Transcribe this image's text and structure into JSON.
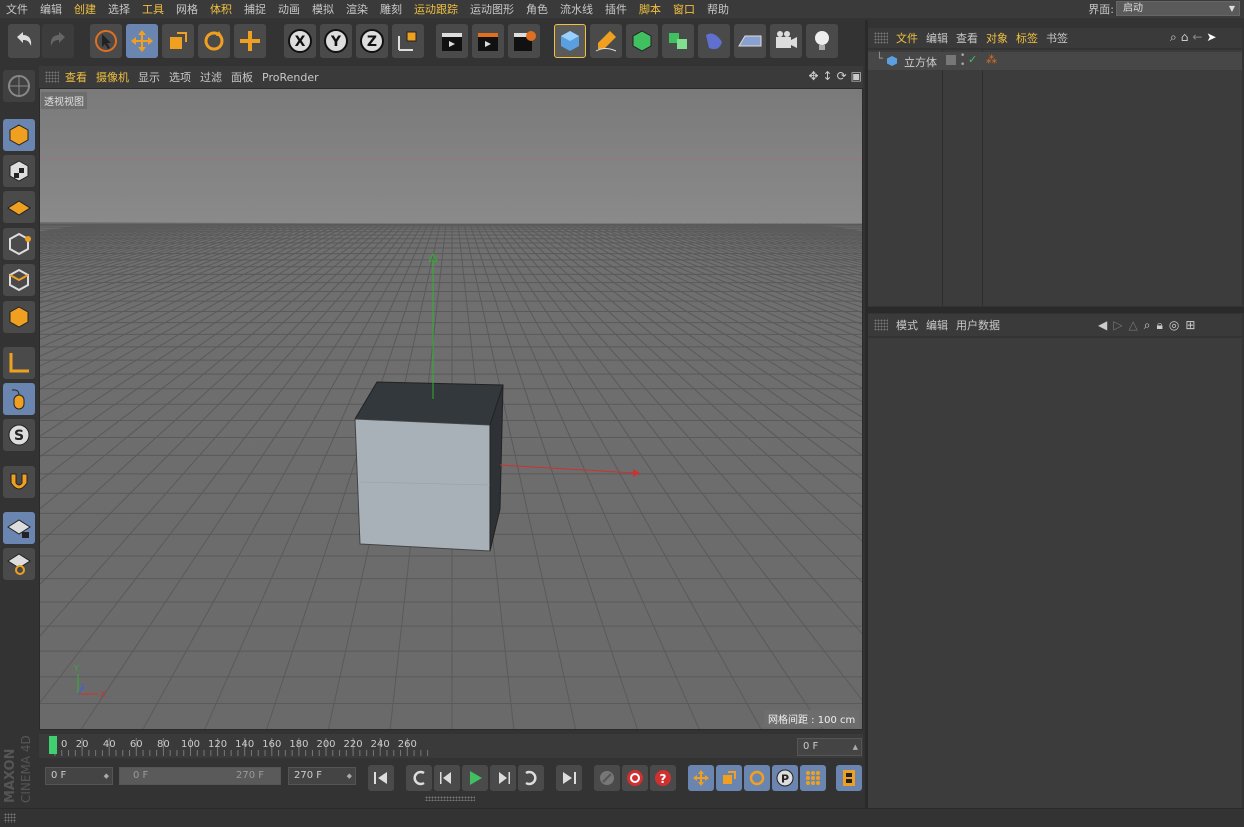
{
  "menubar": {
    "items": [
      {
        "label": "文件",
        "hl": false
      },
      {
        "label": "编辑",
        "hl": false
      },
      {
        "label": "创建",
        "hl": true
      },
      {
        "label": "选择",
        "hl": false
      },
      {
        "label": "工具",
        "hl": true
      },
      {
        "label": "网格",
        "hl": false
      },
      {
        "label": "体积",
        "hl": true
      },
      {
        "label": "捕捉",
        "hl": false
      },
      {
        "label": "动画",
        "hl": false
      },
      {
        "label": "模拟",
        "hl": false
      },
      {
        "label": "渲染",
        "hl": false
      },
      {
        "label": "雕刻",
        "hl": false
      },
      {
        "label": "运动跟踪",
        "hl": true
      },
      {
        "label": "运动图形",
        "hl": false
      },
      {
        "label": "角色",
        "hl": false
      },
      {
        "label": "流水线",
        "hl": false
      },
      {
        "label": "插件",
        "hl": false
      },
      {
        "label": "脚本",
        "hl": true
      },
      {
        "label": "窗口",
        "hl": true
      },
      {
        "label": "帮助",
        "hl": false
      }
    ],
    "layout_label": "界面:",
    "layout_value": "启动"
  },
  "viewport": {
    "menu": [
      {
        "label": "查看",
        "hl": true
      },
      {
        "label": "摄像机",
        "hl": true
      },
      {
        "label": "显示",
        "hl": false
      },
      {
        "label": "选项",
        "hl": false
      },
      {
        "label": "过滤",
        "hl": false
      },
      {
        "label": "面板",
        "hl": false
      },
      {
        "label": "ProRender",
        "hl": false
      }
    ],
    "view_label": "透视视图",
    "grid_info": "网格间距 : 100 cm",
    "axis_x": "X",
    "axis_y": "Y",
    "axis_z": "Z"
  },
  "timeline": {
    "ticks": [
      "0",
      "20",
      "40",
      "60",
      "80",
      "100",
      "120",
      "140",
      "160",
      "180",
      "200",
      "220",
      "240",
      "260"
    ],
    "current_frame": "0 F",
    "start_frame": "0 F",
    "range_start": "0 F",
    "range_end": "270 F",
    "end_frame": "270 F"
  },
  "object_manager": {
    "menu": [
      {
        "label": "文件",
        "hl": true
      },
      {
        "label": "编辑",
        "hl": false
      },
      {
        "label": "查看",
        "hl": false
      },
      {
        "label": "对象",
        "hl": true
      },
      {
        "label": "标签",
        "hl": true
      },
      {
        "label": "书签",
        "hl": false
      }
    ],
    "objects": [
      {
        "name": "立方体"
      }
    ]
  },
  "attribute_manager": {
    "menu": [
      {
        "label": "模式"
      },
      {
        "label": "编辑"
      },
      {
        "label": "用户数据"
      }
    ]
  },
  "brand": {
    "maxon": "MAXON",
    "product": "CINEMA 4D"
  },
  "colors": {
    "accent": "#f0c040",
    "selected": "#6a85b0",
    "axis_x": "#d03030",
    "axis_y": "#30b030",
    "axis_z": "#4060d0"
  }
}
